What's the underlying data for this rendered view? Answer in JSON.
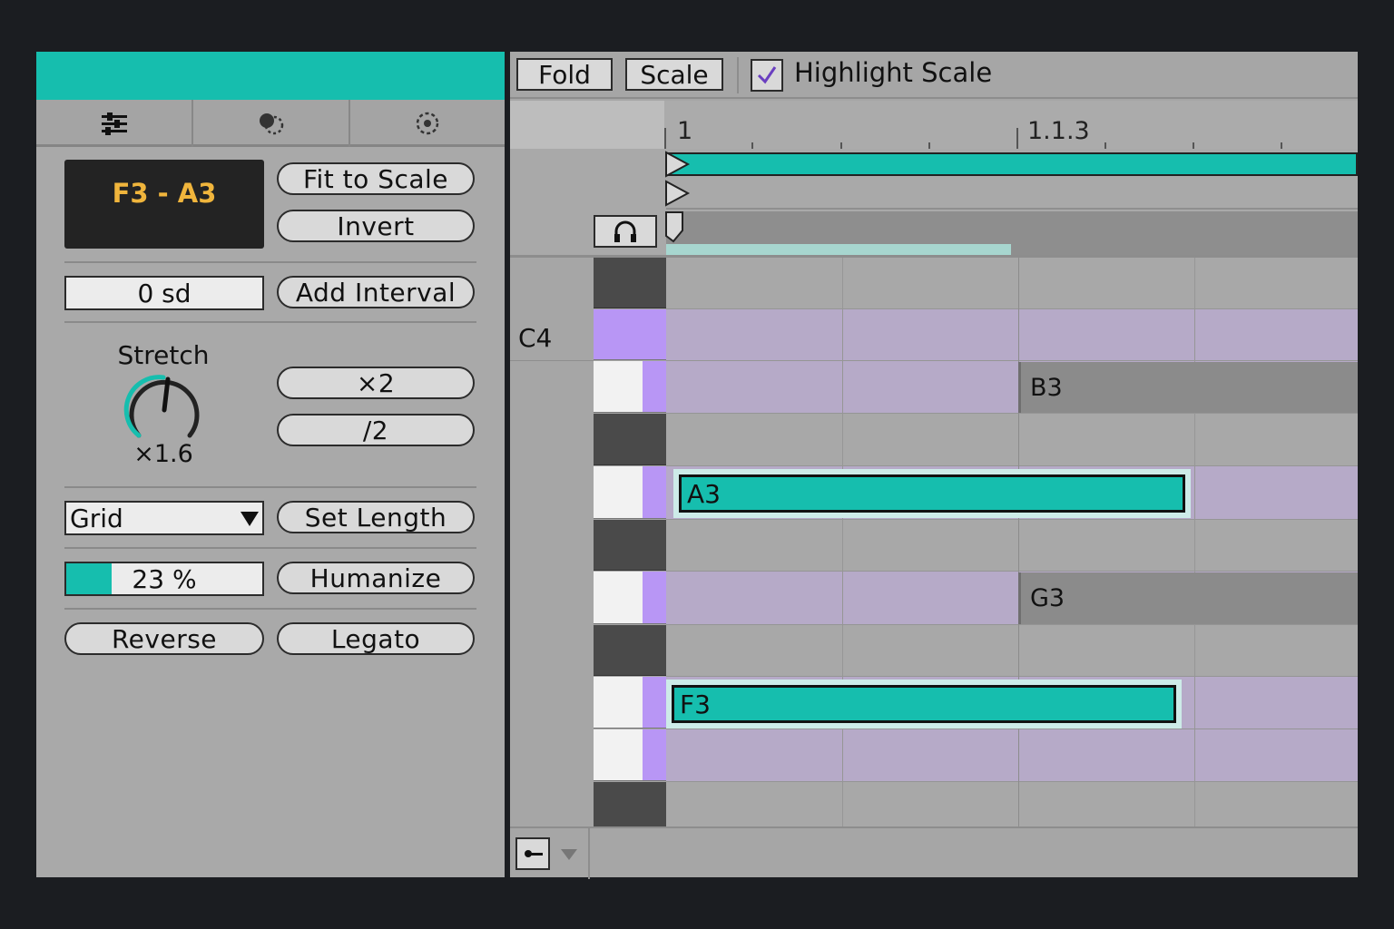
{
  "colors": {
    "accent": "#16beae",
    "scale_highlight": "#b8a8d8",
    "key_purple": "#b896f5",
    "range_text": "#f0b53c"
  },
  "left": {
    "tabs": [
      {
        "icon": "sliders-icon"
      },
      {
        "icon": "envelope-icon"
      },
      {
        "icon": "target-icon"
      }
    ],
    "range": "F3 - A3",
    "fit_to_scale": "Fit to Scale",
    "invert": "Invert",
    "sd_value": "0 sd",
    "add_interval": "Add Interval",
    "stretch_label": "Stretch",
    "stretch_value": "×1.6",
    "times2": "×2",
    "div2": "/2",
    "grid_value": "Grid",
    "set_length": "Set Length",
    "humanize_amount": "23 %",
    "humanize_fraction": 0.23,
    "humanize": "Humanize",
    "reverse": "Reverse",
    "legato": "Legato"
  },
  "right": {
    "fold": "Fold",
    "scale": "Scale",
    "highlight_scale": "Highlight Scale",
    "highlight_checked": true,
    "ruler": [
      "1",
      "1.1.3"
    ],
    "row_label": "C4",
    "notes": [
      {
        "label": "A3",
        "selected": true
      },
      {
        "label": "F3",
        "selected": true
      }
    ],
    "ghost_notes": [
      "B3",
      "G3"
    ]
  }
}
